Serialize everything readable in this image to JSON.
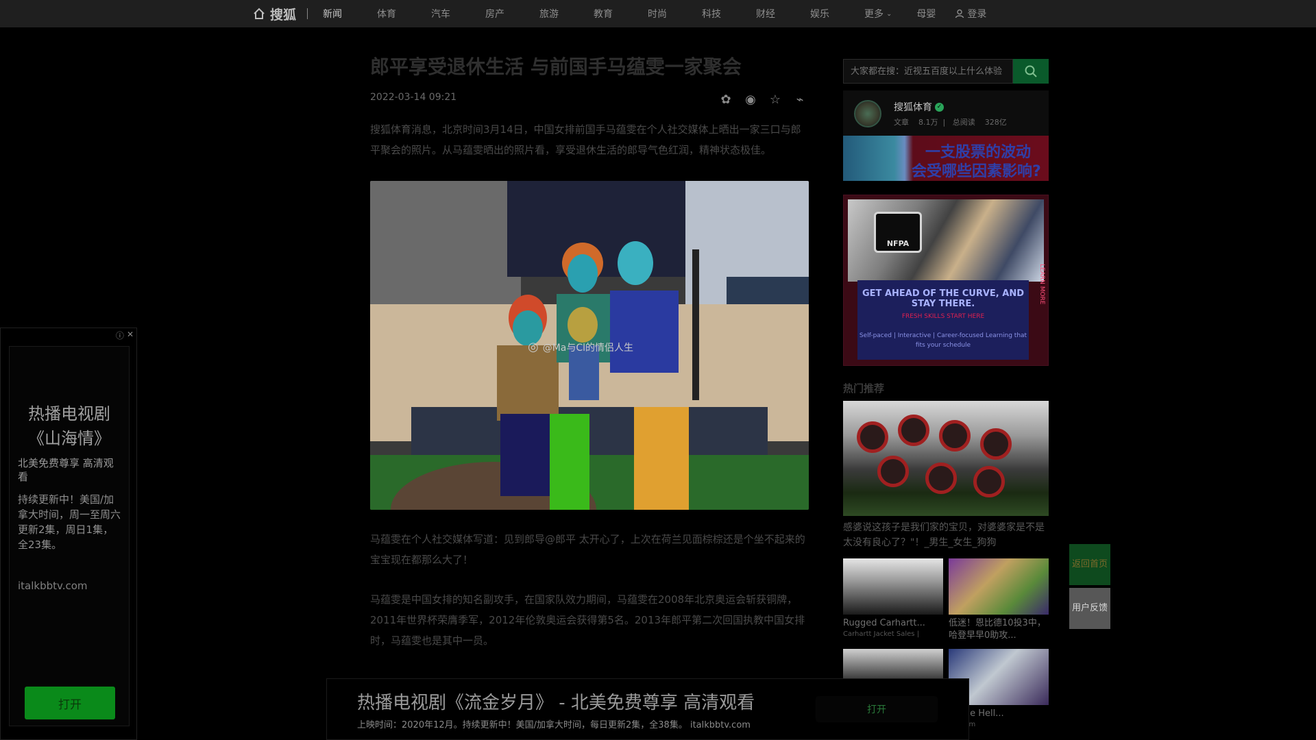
{
  "nav": {
    "logo": "搜狐",
    "items": [
      "新闻",
      "体育",
      "汽车",
      "房产",
      "旅游",
      "教育",
      "时尚",
      "科技",
      "财经",
      "娱乐"
    ],
    "more": "更多",
    "mother_baby": "母婴",
    "login": "登录"
  },
  "article": {
    "title": "郎平享受退休生活 与前国手马蕴雯一家聚会",
    "date": "2022-03-14 09:21",
    "p1": "搜狐体育消息，北京时间3月14日，中国女排前国手马蕴雯在个人社交媒体上晒出一家三口与郎平聚会的照片。从马蕴雯晒出的照片看，享受退休生活的郎导气色红润，精神状态极佳。",
    "watermark": "@Ma与Cl的情侣人生",
    "p2": "马蕴雯在个人社交媒体写道：见到郎导@郎平 太开心了，上次在荷兰见面棕棕还是个坐不起来的宝宝现在都那么大了！",
    "p3": "马蕴雯是中国女排的知名副攻手，在国家队效力期间，马蕴雯在2008年北京奥运会斩获铜牌，2011年世界杯荣膺季军，2012年伦敦奥运会获得第5名。2013年郎平第二次回国执教中国女排时，马蕴雯也是其中一员。"
  },
  "sidebar": {
    "search_placeholder": "大家都在搜：近视五百度以上什么体验",
    "author_name": "搜狐体育",
    "author_stats_articles_label": "文章",
    "author_stats_articles": "8.1万",
    "author_stats_reads_label": "总阅读",
    "author_stats_reads": "328亿",
    "banner_line1": "一支股票的波动",
    "banner_line2": "会受哪些因素影响?",
    "ad": {
      "logo": "NFPA",
      "headline": "GET AHEAD OF THE CURVE, AND STAY THERE.",
      "subline": "FRESH SKILLS START HERE",
      "tags": "Self-paced | Interactive | Career-focused Learning that fits your schedule",
      "vertical": "LEARN MORE"
    },
    "hot_title": "热门推荐",
    "hot_caption": "感婆说这孩子是我们家的宝贝，对婆婆家是不是太没有良心了？\"！_男生_女生_狗狗",
    "cards": [
      {
        "title": "Rugged Carhartt...",
        "sub": "Carhartt Jacket Sales |"
      },
      {
        "title": "低迷！恩比德10投3中，哈登早早0助攻...",
        "sub": ""
      },
      {
        "title": "",
        "sub": ""
      },
      {
        "title": "ill The Hell...",
        "sub": "ory.com"
      }
    ]
  },
  "float": {
    "back": "返回首页",
    "feedback": "用户反馈"
  },
  "left_ad": {
    "title": "热播电视剧《山海情》",
    "line1": "北美免费尊享 高清观看",
    "line2": "持续更新中！美国/加拿大时间，周一至周六更新2集，周日1集，全23集。",
    "domain": "italkbbtv.com",
    "button": "打开"
  },
  "bottom_ad": {
    "title": "热播电视剧《流金岁月》 - 北美免费尊享 高清观看",
    "sub": "上映时间：2020年12月。持续更新中！美国/加拿大时间，每日更新2集，全38集。 italkbbtv.com",
    "button": "打开"
  },
  "colors": {
    "accent_green": "#0a8a1a",
    "nav_bg": "#1f1f1f"
  }
}
